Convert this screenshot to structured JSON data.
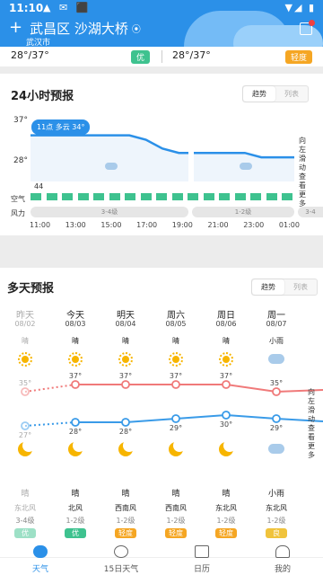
{
  "status": {
    "time": "11:10"
  },
  "header": {
    "city": "武昌区 沙湖大桥",
    "sub": "武汉市"
  },
  "top_strip": {
    "left_temp": "28°/37°",
    "left_aqi": "优",
    "right_temp": "28°/37°",
    "right_aqi": "轻度"
  },
  "hourly": {
    "title": "24小时预报",
    "toggle": [
      "趋势",
      "列表"
    ],
    "y_labels": [
      "37°",
      "28°"
    ],
    "tooltip": "11点 多云 34°",
    "air_label": "空气",
    "wind_label": "风力",
    "aqi_value": "44",
    "wind_pills": [
      "3-4级",
      "1-2级",
      "3-4"
    ],
    "hours": [
      "11:00",
      "13:00",
      "15:00",
      "17:00",
      "19:00",
      "21:00",
      "23:00",
      "01:00"
    ],
    "side_hint": "向左滑动查看更多",
    "temps": [
      34,
      34,
      34,
      34,
      34,
      34,
      34,
      33,
      31,
      30,
      30,
      30,
      30,
      30,
      29,
      29,
      29
    ],
    "accent": "#2b90e8",
    "aqi_color": "#3ec28f"
  },
  "multiday": {
    "title": "多天预报",
    "toggle": [
      "趋势",
      "列表"
    ],
    "side_hint": "向左滑动查看更多",
    "days": [
      {
        "name": "昨天",
        "date": "08/02",
        "day_weather": "晴",
        "day_icon": "sun-icon",
        "high": "35°",
        "low": "27°",
        "night_icon": "moon-icon",
        "night_weather": "晴",
        "wind": "东北风",
        "level": "3-4级",
        "aqi": "优"
      },
      {
        "name": "今天",
        "date": "08/03",
        "day_weather": "晴",
        "day_icon": "sun-icon",
        "high": "37°",
        "low": "28°",
        "night_icon": "moon-icon",
        "night_weather": "晴",
        "wind": "北风",
        "level": "1-2级",
        "aqi": "优"
      },
      {
        "name": "明天",
        "date": "08/04",
        "day_weather": "晴",
        "day_icon": "sun-icon",
        "high": "37°",
        "low": "28°",
        "night_icon": "moon-icon",
        "night_weather": "晴",
        "wind": "西南风",
        "level": "1-2级",
        "aqi": "轻度"
      },
      {
        "name": "周六",
        "date": "08/05",
        "day_weather": "晴",
        "day_icon": "sun-icon",
        "high": "37°",
        "low": "29°",
        "night_icon": "moon-icon",
        "night_weather": "晴",
        "wind": "西南风",
        "level": "1-2级",
        "aqi": "轻度"
      },
      {
        "name": "周日",
        "date": "08/06",
        "day_weather": "晴",
        "day_icon": "sun-icon",
        "high": "37°",
        "low": "30°",
        "night_icon": "moon-icon",
        "night_weather": "晴",
        "wind": "东北风",
        "level": "1-2级",
        "aqi": "轻度"
      },
      {
        "name": "周一",
        "date": "08/07",
        "day_weather": "小雨",
        "day_icon": "cloud-icon",
        "high": "35°",
        "low": "29°",
        "night_icon": "cloud-icon",
        "night_weather": "小雨",
        "wind": "东北风",
        "level": "1-2级",
        "aqi": "良"
      }
    ],
    "high_color": "#f07a7a",
    "low_color": "#3a9be8"
  },
  "nav": [
    {
      "label": "天气",
      "icon": "weather-icon"
    },
    {
      "label": "15日天气",
      "icon": "sun-15-icon"
    },
    {
      "label": "日历",
      "icon": "calendar-icon"
    },
    {
      "label": "我的",
      "icon": "profile-icon"
    }
  ]
}
